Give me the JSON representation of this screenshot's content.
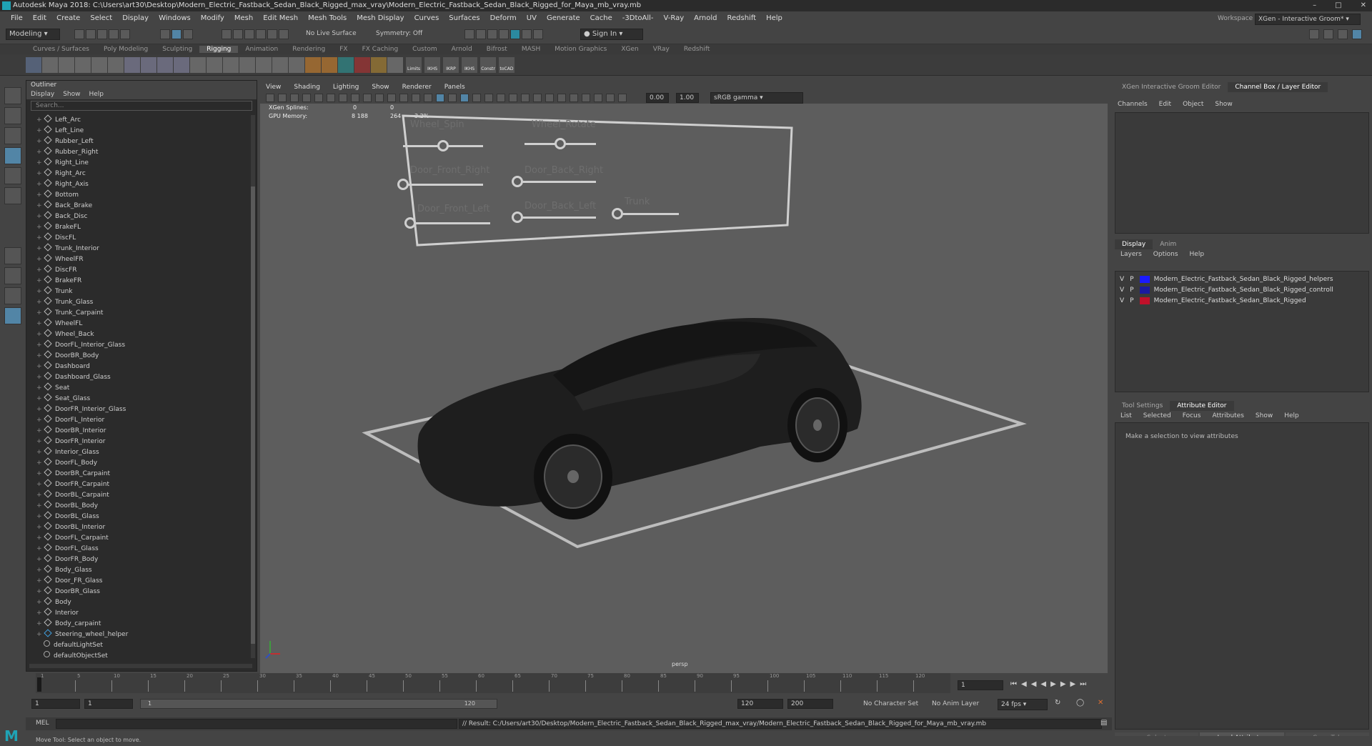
{
  "window": {
    "title": "Autodesk Maya 2018: C:\\Users\\art30\\Desktop\\Modern_Electric_Fastback_Sedan_Black_Rigged_max_vray\\Modern_Electric_Fastback_Sedan_Black_Rigged_for_Maya_mb_vray.mb"
  },
  "menubar": [
    "File",
    "Edit",
    "Create",
    "Select",
    "Display",
    "Windows",
    "Modify",
    "Mesh",
    "Edit Mesh",
    "Mesh Tools",
    "Mesh Display",
    "Curves",
    "Surfaces",
    "Deform",
    "UV",
    "Generate",
    "Cache",
    "-3DtoAll-",
    "V-Ray",
    "Arnold",
    "Redshift",
    "Help"
  ],
  "statusline": {
    "mode": "Modeling",
    "live_surface": "No Live Surface",
    "symmetry": "Symmetry: Off",
    "sign_in": "Sign In",
    "workspace_label": "Workspace :",
    "workspace_value": "XGen - Interactive Groom*"
  },
  "shelf_tabs": [
    "Curves / Surfaces",
    "Poly Modeling",
    "Sculpting",
    "Rigging",
    "Animation",
    "Rendering",
    "FX",
    "FX Caching",
    "Custom",
    "Arnold",
    "Bifrost",
    "MASH",
    "Motion Graphics",
    "XGen",
    "VRay",
    "Redshift"
  ],
  "shelf_active": "Rigging",
  "shelf_labels": [
    "Limits",
    "IKHS",
    "IKRP",
    "IKHS",
    "Constr",
    "toCAD"
  ],
  "outliner": {
    "title": "Outliner",
    "menu": [
      "Display",
      "Show",
      "Help"
    ],
    "search_placeholder": "Search...",
    "items": [
      "Left_Arc",
      "Left_Line",
      "Rubber_Left",
      "Rubber_Right",
      "Right_Line",
      "Right_Arc",
      "Right_Axis",
      "Bottom",
      "Back_Brake",
      "Back_Disc",
      "BrakeFL",
      "DiscFL",
      "Trunk_Interior",
      "WheelFR",
      "DiscFR",
      "BrakeFR",
      "Trunk",
      "Trunk_Glass",
      "Trunk_Carpaint",
      "WheelFL",
      "Wheel_Back",
      "DoorFL_Interior_Glass",
      "DoorBR_Body",
      "Dashboard",
      "Dashboard_Glass",
      "Seat",
      "Seat_Glass",
      "DoorFR_Interior_Glass",
      "DoorFL_Interior",
      "DoorBR_Interior",
      "DoorFR_Interior",
      "Interior_Glass",
      "DoorFL_Body",
      "DoorBR_Carpaint",
      "DoorFR_Carpaint",
      "DoorBL_Carpaint",
      "DoorBL_Body",
      "DoorBL_Glass",
      "DoorBL_Interior",
      "DoorFL_Carpaint",
      "DoorFL_Glass",
      "DoorFR_Body",
      "Body_Glass",
      "Door_FR_Glass",
      "DoorBR_Glass",
      "Body",
      "Interior",
      "Body_carpaint",
      "Steering_wheel_helper",
      "defaultLightSet",
      "defaultObjectSet"
    ]
  },
  "viewport": {
    "menu": [
      "View",
      "Shading",
      "Lighting",
      "Show",
      "Renderer",
      "Panels"
    ],
    "exposure": "0.00",
    "gamma": "1.00",
    "color_space": "sRGB gamma",
    "hud": {
      "xgen_label": "XGen Splines:",
      "xgen_a": "0",
      "xgen_b": "0",
      "gpu_label": "GPU Memory:",
      "gpu_a": "8 188",
      "gpu_b": "264",
      "gpu_c": "3.2%"
    },
    "camera_label": "persp",
    "controls": [
      {
        "label": "Wheel_Spin",
        "value": 0.5
      },
      {
        "label": "Wheel_Rotate",
        "value": 0.5
      },
      {
        "label": "Door_Front_Right",
        "value": 0.0
      },
      {
        "label": "Door_Back_Right",
        "value": 0.0
      },
      {
        "label": "Door_Front_Left",
        "value": 0.0
      },
      {
        "label": "Door_Back_Left",
        "value": 0.0
      },
      {
        "label": "Trunk",
        "value": 0.0
      }
    ]
  },
  "right_panel": {
    "top_tabs": [
      "XGen Interactive Groom Editor",
      "Channel Box / Layer Editor"
    ],
    "top_active": "Channel Box / Layer Editor",
    "channel_menu": [
      "Channels",
      "Edit",
      "Object",
      "Show"
    ],
    "layer_tabs": [
      "Display",
      "Anim"
    ],
    "layer_menu": [
      "Layers",
      "Options",
      "Help"
    ],
    "layers": [
      {
        "v": "V",
        "p": "P",
        "name": "Modern_Electric_Fastback_Sedan_Black_Rigged_helpers",
        "color": "#1a1aff"
      },
      {
        "v": "V",
        "p": "P",
        "name": "Modern_Electric_Fastback_Sedan_Black_Rigged_controll",
        "color": "#1a1aa0"
      },
      {
        "v": "V",
        "p": "P",
        "name": "Modern_Electric_Fastback_Sedan_Black_Rigged",
        "color": "#c0102a"
      }
    ],
    "attr_tabs": [
      "Tool Settings",
      "Attribute Editor"
    ],
    "attr_active": "Attribute Editor",
    "attr_menu": [
      "List",
      "Selected",
      "Focus",
      "Attributes",
      "Show",
      "Help"
    ],
    "attr_message": "Make a selection to view attributes",
    "bottom_buttons": [
      "Select",
      "Load Attributes",
      "Copy Tab"
    ]
  },
  "timeline": {
    "ticks": [
      "1",
      "5",
      "10",
      "15",
      "20",
      "25",
      "30",
      "35",
      "40",
      "45",
      "50",
      "55",
      "60",
      "65",
      "70",
      "75",
      "80",
      "85",
      "90",
      "95",
      "100",
      "105",
      "110",
      "115",
      "120"
    ],
    "current_frame": "1"
  },
  "range": {
    "start": "1",
    "start2": "1",
    "slider_start": "1",
    "slider_end": "120",
    "end": "120",
    "end2": "200",
    "character_set": "No Character Set",
    "anim_layer": "No Anim Layer",
    "fps": "24 fps"
  },
  "mel": {
    "label": "MEL",
    "result": "// Result: C:/Users/art30/Desktop/Modern_Electric_Fastback_Sedan_Black_Rigged_max_vray/Modern_Electric_Fastback_Sedan_Black_Rigged_for_Maya_mb_vray.mb"
  },
  "help_line": "Move Tool: Select an object to move."
}
